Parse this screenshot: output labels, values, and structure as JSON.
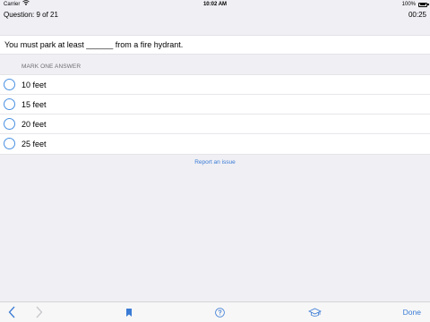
{
  "status_bar": {
    "carrier": "Carrier",
    "time": "10:02 AM",
    "battery": "100%"
  },
  "quiz_header": {
    "question_counter": "Question: 9 of 21",
    "timer": "00:25"
  },
  "question": {
    "text": "You must park at least ______ from a fire hydrant."
  },
  "answers_section": {
    "label": "MARK ONE ANSWER",
    "options": [
      {
        "label": "10 feet",
        "selected": false
      },
      {
        "label": "15 feet",
        "selected": false
      },
      {
        "label": "20 feet",
        "selected": false
      },
      {
        "label": "25 feet",
        "selected": false
      }
    ]
  },
  "report_link": "Report an issue",
  "toolbar": {
    "back_icon": "chevron-left-icon",
    "forward_icon": "chevron-right-icon",
    "bookmark_icon": "bookmark-icon",
    "help_icon": "help-circle-icon",
    "learn_icon": "graduation-cap-icon",
    "done_label": "Done"
  },
  "colors": {
    "accent": "#3a7bd5",
    "background": "#efeff4",
    "card": "#ffffff"
  }
}
